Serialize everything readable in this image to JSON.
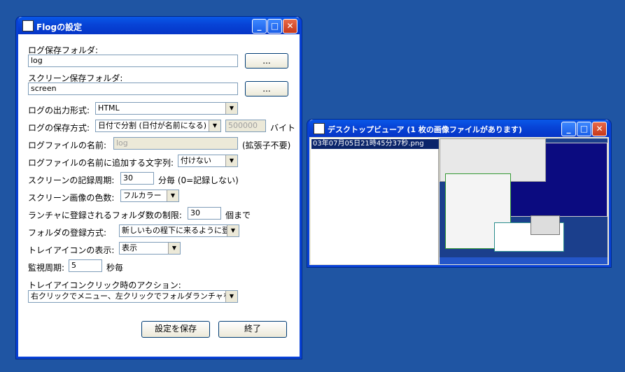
{
  "settings_window": {
    "title": "Flogの設定",
    "log_folder_label": "ログ保存フォルダ:",
    "log_folder_value": "log",
    "browse_label": "...",
    "screen_folder_label": "スクリーン保存フォルダ:",
    "screen_folder_value": "screen",
    "output_format_label": "ログの出力形式:",
    "output_format_value": "HTML",
    "save_method_label": "ログの保存方式:",
    "save_method_value": "日付で分割 (日付が名前になる)",
    "save_size_value": "500000",
    "byte_label": "バイト",
    "log_filename_label": "ログファイルの名前:",
    "log_filename_value": "log",
    "ext_note": "(拡張子不要)",
    "suffix_label": "ログファイルの名前に追加する文字列:",
    "suffix_value": "付けない",
    "screen_interval_label": "スクリーンの記録周期:",
    "screen_interval_value": "30",
    "screen_interval_unit": "分毎 (0=記録しない)",
    "color_depth_label": "スクリーン画像の色数:",
    "color_depth_value": "フルカラー",
    "launcher_limit_label": "ランチャに登録されるフォルダ数の制限:",
    "launcher_limit_value": "30",
    "launcher_limit_unit": "個まで",
    "register_method_label": "フォルダの登録方式:",
    "register_method_value": "新しいもの程下に来るように登録",
    "tray_icon_label": "トレイアイコンの表示:",
    "tray_icon_value": "表示",
    "watch_interval_label": "監視周期:",
    "watch_interval_value": "5",
    "watch_interval_unit": "秒毎",
    "tray_click_label": "トレイアイコンクリック時のアクション:",
    "tray_click_value": "右クリックでメニュー、左クリックでフォルダランチャを表示",
    "save_button": "設定を保存",
    "exit_button": "終了"
  },
  "viewer_window": {
    "title": "デスクトップビューア (1 枚の画像ファイルがあります)",
    "files": [
      "03年07月05日21時45分37秒.png"
    ]
  },
  "colors": {
    "desktop": "#1f55a3",
    "titlebar": "#0743d6",
    "selection": "#0a246a"
  }
}
